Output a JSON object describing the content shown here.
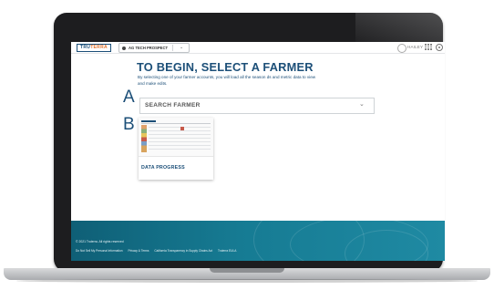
{
  "header": {
    "logo_text_a": "TRU",
    "logo_text_b": "TERRA",
    "account_select": "AG TECH PROSPECT",
    "user_name": "HAILEY"
  },
  "main": {
    "heading": "TO BEGIN, SELECT A FARMER",
    "intro": "By selecting one of your farmer accounts, you will load all the season ds and metric data to view and make edits.",
    "callout_a": "A",
    "callout_b": "B",
    "search_label": "SEARCH FARMER",
    "card_title": "DATA PROGRESS"
  },
  "footer": {
    "copyright": "© 2021 Truterra. All rights reserved",
    "links": [
      "Do Not Sell My Personal Information",
      "Privacy & Terms",
      "California Transparency in Supply Chains Act",
      "Truterra EULA"
    ]
  },
  "colors": {
    "brand_blue": "#1c4f78",
    "brand_orange": "#e0712c",
    "footer_teal": "#167b93"
  }
}
